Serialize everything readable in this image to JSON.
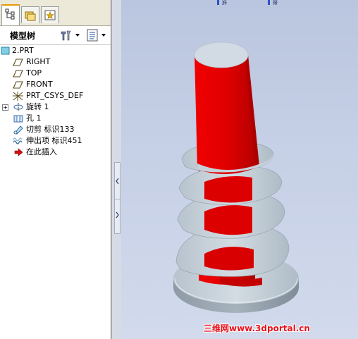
{
  "model_tree": {
    "title": "模型树",
    "items": [
      {
        "label": "2.PRT",
        "icon": "part-icon"
      },
      {
        "label": "RIGHT",
        "icon": "datum-plane-icon"
      },
      {
        "label": "TOP",
        "icon": "datum-plane-icon"
      },
      {
        "label": "FRONT",
        "icon": "datum-plane-icon"
      },
      {
        "label": "PRT_CSYS_DEF",
        "icon": "coordinate-system-icon"
      },
      {
        "label": "旋转 1",
        "icon": "revolve-icon"
      },
      {
        "label": "孔 1",
        "icon": "hole-icon"
      },
      {
        "label": "切剪 标识133",
        "icon": "cut-icon"
      },
      {
        "label": "伸出项 标识451",
        "icon": "protrusion-icon"
      },
      {
        "label": "在此插入",
        "icon": "insert-here-arrow-icon"
      }
    ]
  },
  "view_tabs": [
    "准",
    "景"
  ],
  "watermark": "三维网www.3dportal.cn",
  "colors": {
    "model_red": "#e00000",
    "thread_gray": "#c9d4dc",
    "background_top": "#bac6df",
    "watermark_red": "#e8121e"
  }
}
